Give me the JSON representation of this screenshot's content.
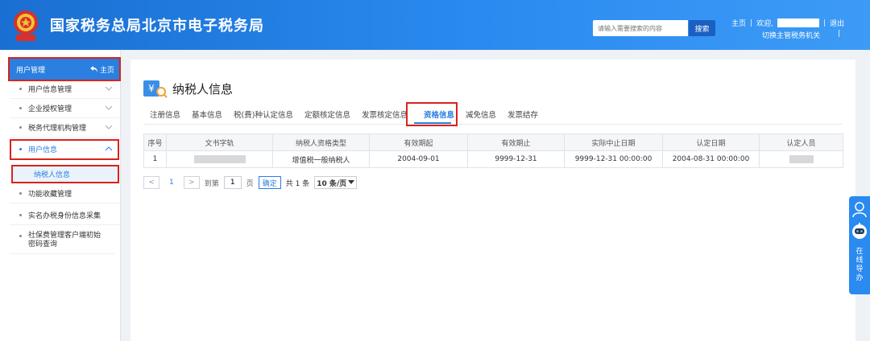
{
  "header": {
    "title": "国家税务总局北京市电子税务局",
    "search_placeholder": "请输入需要搜索的内容",
    "search_button": "搜索",
    "home_link": "主页",
    "welcome": "欢迎,",
    "logout": "退出",
    "switch_authority": "切换主管税务机关",
    "separator": "|"
  },
  "sidebar": {
    "header_label": "用户管理",
    "home_label": "主页",
    "items": [
      {
        "label": "用户信息管理"
      },
      {
        "label": "企业授权管理"
      },
      {
        "label": "税务代理机构管理"
      },
      {
        "label": "用户信息"
      },
      {
        "label": "纳税人信息"
      },
      {
        "label": "功能收藏管理"
      },
      {
        "label": "实名办税身份信息采集"
      },
      {
        "label": "社保费管理客户端初始密码查询"
      }
    ]
  },
  "main": {
    "title": "纳税人信息",
    "tabs": [
      "注册信息",
      "基本信息",
      "税(费)种认定信息",
      "定额核定信息",
      "发票核定信息",
      "资格信息",
      "减免信息",
      "发票结存"
    ],
    "active_tab_index": 5,
    "table": {
      "headers": [
        "序号",
        "文书字轨",
        "纳税人资格类型",
        "有效期起",
        "有效期止",
        "实际中止日期",
        "认定日期",
        "认定人员"
      ],
      "rows": [
        [
          "1",
          "",
          "增值税一般纳税人",
          "2004-09-01",
          "9999-12-31",
          "9999-12-31 00:00:00",
          "2004-08-31 00:00:00",
          ""
        ]
      ]
    },
    "pager": {
      "prev": "<",
      "current_page": "1",
      "next": ">",
      "goto_label": "到第",
      "goto_value": "1",
      "page_unit": "页",
      "confirm": "确定",
      "total": "共 1 条",
      "page_size": "10 条/页"
    }
  },
  "float_widget": {
    "text": "在线导办"
  },
  "colors": {
    "header_blue": "#2a8af0",
    "accent": "#2a7fe0",
    "highlight_red": "#d9231b"
  },
  "icons": {
    "emblem": "national-emblem-icon",
    "home": "home-arrow-icon",
    "chevron": "chevron-down-icon",
    "chevron_up": "chevron-up-icon",
    "page": "taxpayer-search-icon",
    "avatar": "user-avatar-icon",
    "robot": "robot-assistant-icon"
  }
}
